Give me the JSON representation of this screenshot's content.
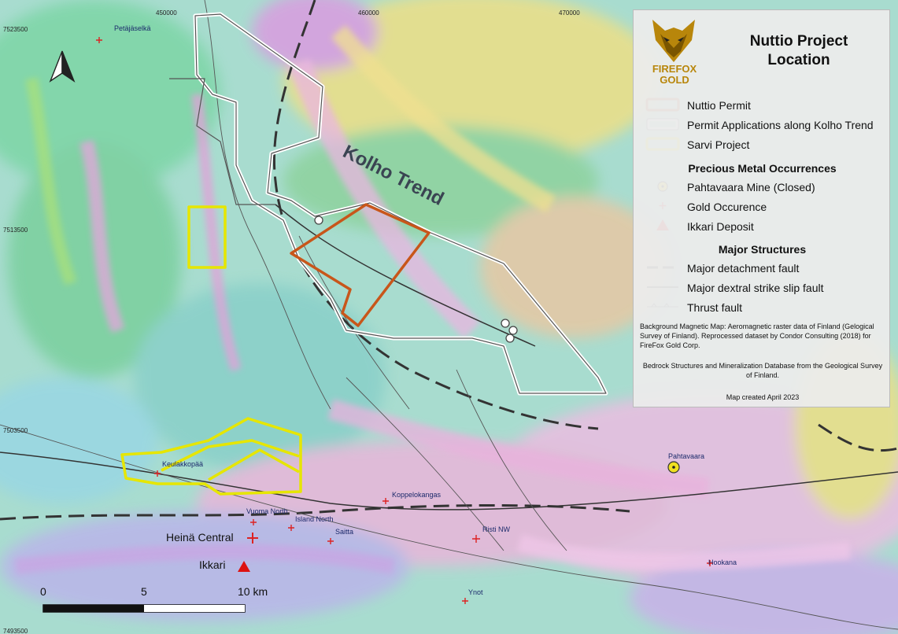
{
  "legend": {
    "title_line1": "Nuttio Project",
    "title_line2": "Location",
    "brand_line1": "FIREFOX",
    "brand_line2": "GOLD",
    "permits": [
      {
        "label": "Nuttio Permit",
        "color": "#c8561a"
      },
      {
        "label": "Permit Applications along Kolho Trend",
        "color": "#ffffff"
      },
      {
        "label": "Sarvi Project",
        "color": "#e6e600"
      }
    ],
    "occurrences_title": "Precious Metal Occurrences",
    "occurrences": [
      {
        "label": "Pahtavaara Mine (Closed)",
        "icon": "mine-icon"
      },
      {
        "label": "Gold Occurence",
        "icon": "cross-icon"
      },
      {
        "label": "Ikkari Deposit",
        "icon": "triangle-icon"
      }
    ],
    "structures_title": "Major Structures",
    "structures": [
      {
        "label": "Major detachment fault",
        "style": "dashed"
      },
      {
        "label": "Major dextral strike slip fault",
        "style": "solid"
      },
      {
        "label": "Thrust fault",
        "style": "thrust"
      }
    ],
    "note1": "Background Magnetic Map: Aeromagnetic raster data of Finland (Gelogical Survey of Finland). Reprocessed dataset by Condor Consulting (2018) for FireFox Gold Corp.",
    "note2": "Bedrock Structures and Mineralization Database from the Geological Survey of Finland.",
    "note3": "Map created April 2023"
  },
  "map": {
    "trend_label": "Kolho Trend",
    "x_ticks": [
      "450000",
      "460000",
      "470000"
    ],
    "y_ticks": [
      "7523500",
      "7513500",
      "7503500",
      "7493500"
    ],
    "places": [
      {
        "name": "Petäjäselkä"
      },
      {
        "name": "Keulakkopää"
      },
      {
        "name": "Koppelokangas"
      },
      {
        "name": "Vuoma North"
      },
      {
        "name": "Island North"
      },
      {
        "name": "Saitta"
      },
      {
        "name": "Risti NW"
      },
      {
        "name": "Heinä Central"
      },
      {
        "name": "Ikkari"
      },
      {
        "name": "Pahtavaara"
      },
      {
        "name": "Hookana"
      },
      {
        "name": "Ynot"
      }
    ],
    "scale_labels": [
      "0",
      "5",
      "10 km"
    ],
    "north_arrow": "north-arrow-icon",
    "colors": {
      "nuttio": "#c8561a",
      "applications": "#ffffff",
      "sarvi": "#e6e600",
      "gold": "#d22",
      "ikkari": "#d00"
    }
  }
}
